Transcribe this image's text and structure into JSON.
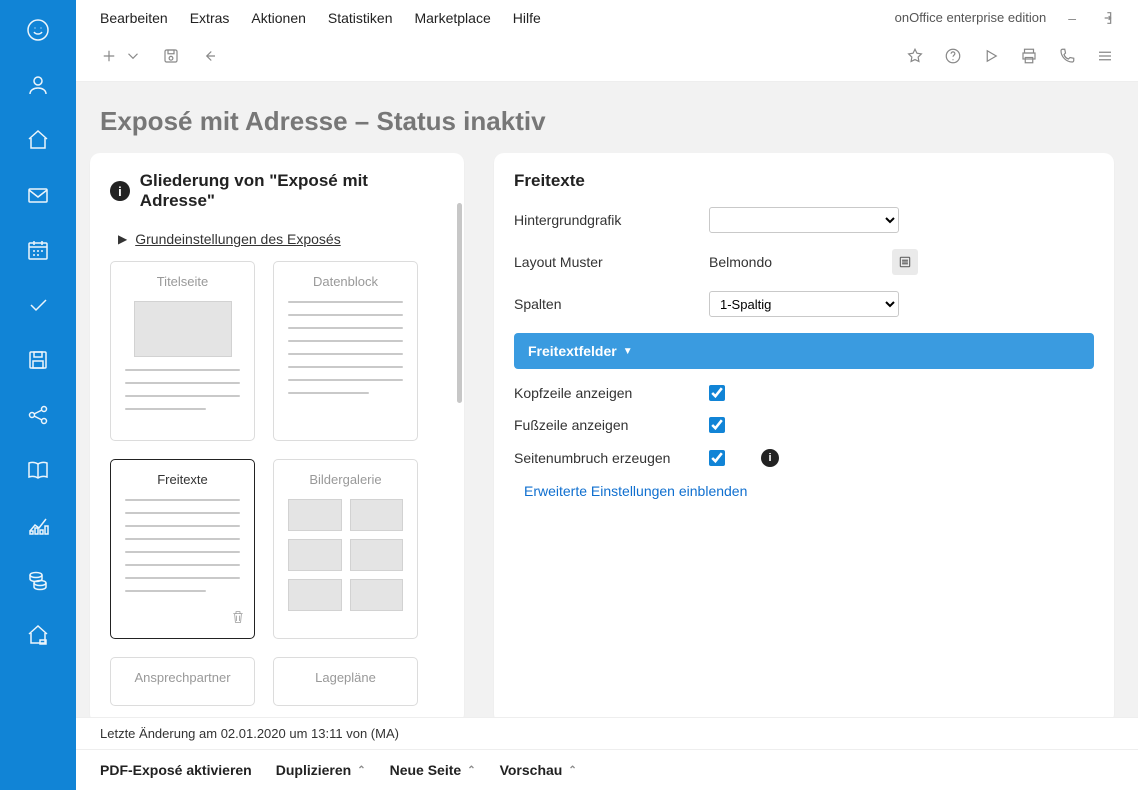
{
  "topmenu": {
    "items": [
      "Bearbeiten",
      "Extras",
      "Aktionen",
      "Statistiken",
      "Marketplace",
      "Hilfe"
    ],
    "edition": "onOffice enterprise edition",
    "dash": "–"
  },
  "page": {
    "title": "Exposé mit Adresse – Status inaktiv"
  },
  "outline": {
    "panel_title": "Gliederung von \"Exposé mit Adresse\"",
    "basis_link": "Grundeinstellungen des Exposés",
    "tiles": {
      "titelseite": "Titelseite",
      "datenblock": "Datenblock",
      "freitexte": "Freitexte",
      "bildergalerie": "Bildergalerie",
      "ansprechpartner": "Ansprechpartner",
      "lageplane": "Lagepläne"
    }
  },
  "freitexte": {
    "panel_title": "Freitexte",
    "labels": {
      "hintergrundgrafik": "Hintergrundgrafik",
      "layout_muster": "Layout Muster",
      "spalten": "Spalten",
      "kopfzeile": "Kopfzeile anzeigen",
      "fusszeile": "Fußzeile anzeigen",
      "seitenumbruch": "Seitenumbruch erzeugen"
    },
    "values": {
      "hintergrundgrafik": "",
      "layout_muster": "Belmondo",
      "spalten": "1-Spaltig",
      "kopfzeile": true,
      "fusszeile": true,
      "seitenumbruch": true
    },
    "section_bar": "Freitextfelder",
    "advanced_link": "Erweiterte Einstellungen einblenden"
  },
  "footer": {
    "last_change": "Letzte Änderung am 02.01.2020 um 13:11 von (MA)",
    "actions": {
      "aktivieren": "PDF-Exposé aktivieren",
      "duplizieren": "Duplizieren",
      "neue_seite": "Neue Seite",
      "vorschau": "Vorschau"
    }
  }
}
